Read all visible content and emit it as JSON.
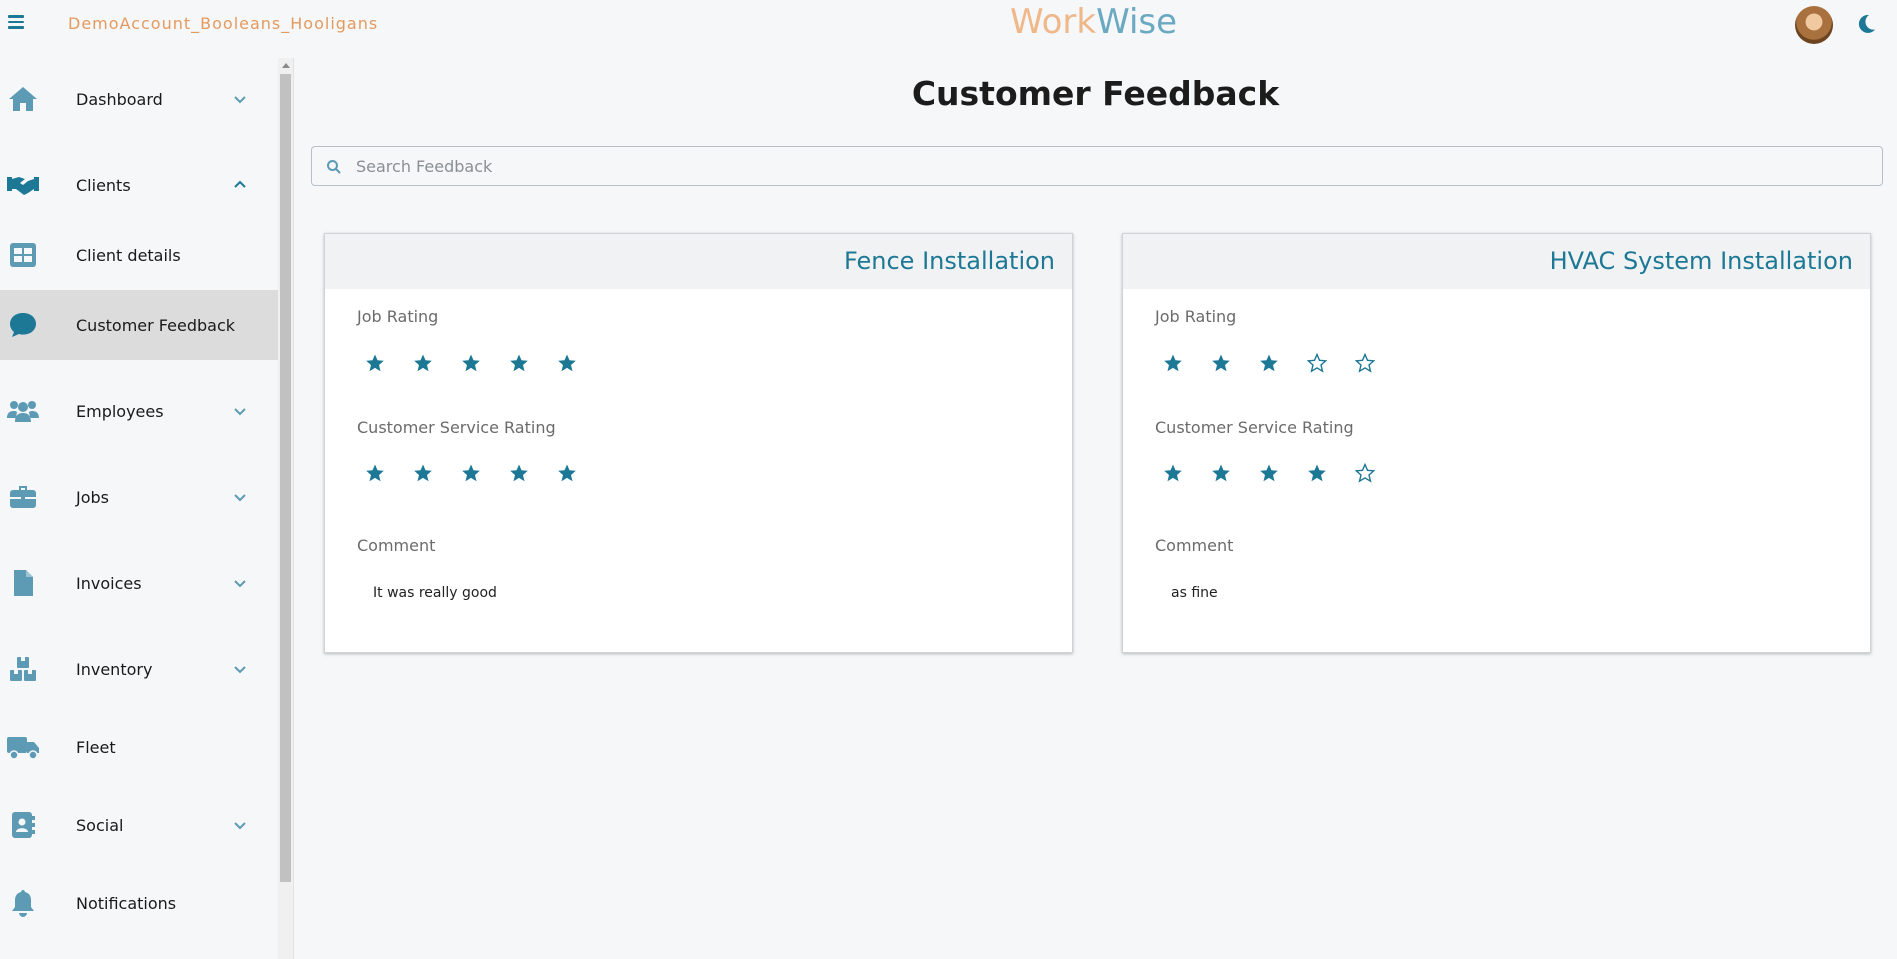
{
  "topbar": {
    "account_name": "DemoAccount_Booleans_Hooligans",
    "brand_part1": "Work",
    "brand_part2": "Wise"
  },
  "sidebar": {
    "items": [
      {
        "label": "Dashboard",
        "icon": "home-icon",
        "expandable": true,
        "expanded": false
      },
      {
        "label": "Clients",
        "icon": "handshake-icon",
        "expandable": true,
        "expanded": true
      },
      {
        "label": "Client details",
        "icon": "table-icon",
        "expandable": false
      },
      {
        "label": "Customer Feedback",
        "icon": "chat-bubble-icon",
        "expandable": false,
        "active": true
      },
      {
        "label": "Employees",
        "icon": "people-icon",
        "expandable": true,
        "expanded": false
      },
      {
        "label": "Jobs",
        "icon": "briefcase-icon",
        "expandable": true,
        "expanded": false
      },
      {
        "label": "Invoices",
        "icon": "document-icon",
        "expandable": true,
        "expanded": false
      },
      {
        "label": "Inventory",
        "icon": "boxes-icon",
        "expandable": true,
        "expanded": false
      },
      {
        "label": "Fleet",
        "icon": "truck-icon",
        "expandable": false
      },
      {
        "label": "Social",
        "icon": "contact-book-icon",
        "expandable": true,
        "expanded": false
      },
      {
        "label": "Notifications",
        "icon": "bell-icon",
        "expandable": false
      }
    ]
  },
  "main": {
    "title": "Customer Feedback",
    "search_placeholder": "Search Feedback",
    "labels": {
      "job_rating": "Job Rating",
      "service_rating": "Customer Service Rating",
      "comment": "Comment"
    },
    "cards": [
      {
        "title": "Fence Installation",
        "job_rating": 5,
        "service_rating": 5,
        "comment": "It was really good"
      },
      {
        "title": "HVAC System Installation",
        "job_rating": 3,
        "service_rating": 4,
        "comment": "as fine"
      }
    ]
  },
  "colors": {
    "accent": "#1d7896",
    "icon": "#5d9bb5",
    "account": "#e49a5e",
    "active_bg": "#dcdcdc"
  }
}
